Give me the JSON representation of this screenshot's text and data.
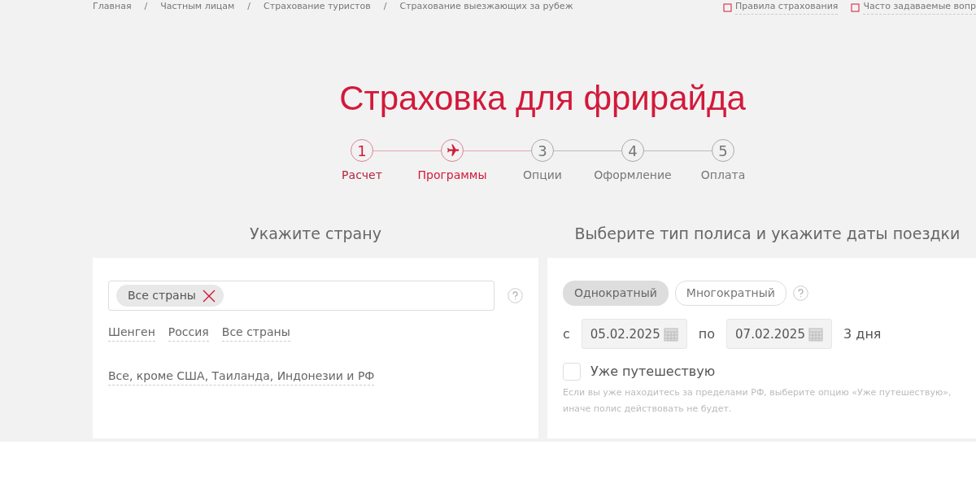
{
  "breadcrumbs": [
    "Главная",
    "Частным лицам",
    "Страхование туристов",
    "Страхование выезжающих за рубеж"
  ],
  "breadcrumb_separator": "/",
  "top_links": [
    "Правила страхования",
    "Часто задаваемые вопр"
  ],
  "title": "Страховка для фрирайда",
  "steps": [
    {
      "number": "1",
      "label": "Расчет",
      "completed": true,
      "current": false
    },
    {
      "label": "Программы",
      "completed": false,
      "current": true
    },
    {
      "number": "3",
      "label": "Опции",
      "completed": false,
      "current": false
    },
    {
      "number": "4",
      "label": "Оформление",
      "completed": false,
      "current": false
    },
    {
      "number": "5",
      "label": "Оплата",
      "completed": false,
      "current": false
    }
  ],
  "country": {
    "heading": "Укажите страну",
    "tags": [
      "Все страны"
    ],
    "quick_links": [
      "Шенген",
      "Россия",
      "Все страны",
      "Все, кроме США, Таиланда, Индонезии и РФ"
    ]
  },
  "policy": {
    "heading": "Выберите тип полиса и укажите даты поездки",
    "types": [
      {
        "label": "Однократный",
        "selected": true
      },
      {
        "label": "Многократный",
        "selected": false
      }
    ],
    "from_label": "с",
    "from": "05.02.2025",
    "to_label": "по",
    "to": "07.02.2025",
    "duration": "3 дня",
    "already_travelling": {
      "label": "Уже путешествую",
      "checked": false
    },
    "note": "Если вы уже находитесь за пределами РФ, выберите опцию «Уже путешествую», иначе полис действовать не будет."
  }
}
